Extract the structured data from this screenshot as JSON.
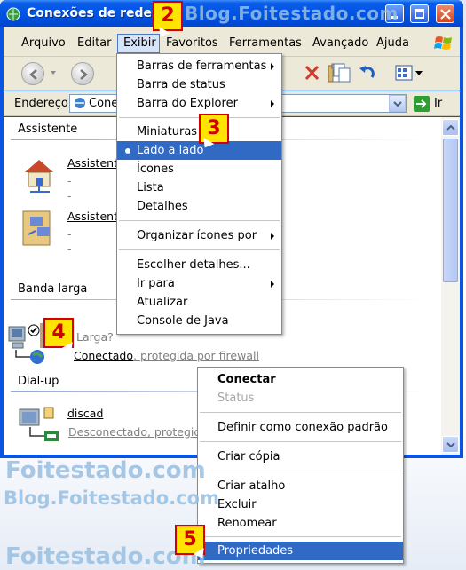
{
  "window": {
    "title": "Conexões de rede"
  },
  "menubar": {
    "items": [
      "Arquivo",
      "Editar",
      "Exibir",
      "Favoritos",
      "Ferramentas",
      "Avançado",
      "Ajuda"
    ]
  },
  "address": {
    "label": "Endereço",
    "value": "Cone",
    "go": "Ir"
  },
  "groups": {
    "assistente": {
      "title": "Assistente",
      "items": [
        {
          "link": "Assistente",
          "line1": "-",
          "line2": "-"
        },
        {
          "link": "Assistente",
          "line1": "-",
          "line2": "-"
        }
      ]
    },
    "banda_larga": {
      "title": "Banda larga",
      "item": {
        "name": "Larga?",
        "status": "Conectado",
        "status_extra": ", protegida por firewall"
      }
    },
    "dialup": {
      "title": "Dial-up",
      "item": {
        "name": "discad",
        "status": "Desconectado, protegid"
      }
    }
  },
  "view_menu": {
    "items": [
      {
        "label": "Barras de ferramentas",
        "submenu": true
      },
      {
        "label": "Barra de status"
      },
      {
        "label": "Barra do Explorer",
        "submenu": true
      },
      {
        "label": "Miniaturas"
      },
      {
        "label": "Lado a lado",
        "selected": true
      },
      {
        "label": "Ícones"
      },
      {
        "label": "Lista"
      },
      {
        "label": "Detalhes"
      },
      {
        "label": "Organizar ícones por",
        "submenu": true
      },
      {
        "label": "Escolher detalhes..."
      },
      {
        "label": "Ir para",
        "submenu": true
      },
      {
        "label": "Atualizar"
      },
      {
        "label": "Console de Java"
      }
    ]
  },
  "context_menu": {
    "items": [
      {
        "label": "Conectar",
        "bold": true
      },
      {
        "label": "Status",
        "disabled": true
      },
      {
        "label": "Definir como conexão padrão"
      },
      {
        "label": "Criar cópia"
      },
      {
        "label": "Criar atalho"
      },
      {
        "label": "Excluir"
      },
      {
        "label": "Renomear"
      },
      {
        "label": "Propriedades",
        "highlighted": true
      }
    ]
  },
  "badges": [
    "2",
    "3",
    "4",
    "5"
  ],
  "watermarks": [
    "Blog.Foitestado.com",
    "Foitestado.com",
    "Blog.Foitestado.com",
    "Foitestado.com"
  ],
  "colors": {
    "titlebar": "#0054e3",
    "menu_highlight": "#316ac5",
    "badge_fill": "#ffe400",
    "badge_text": "#d40000"
  }
}
